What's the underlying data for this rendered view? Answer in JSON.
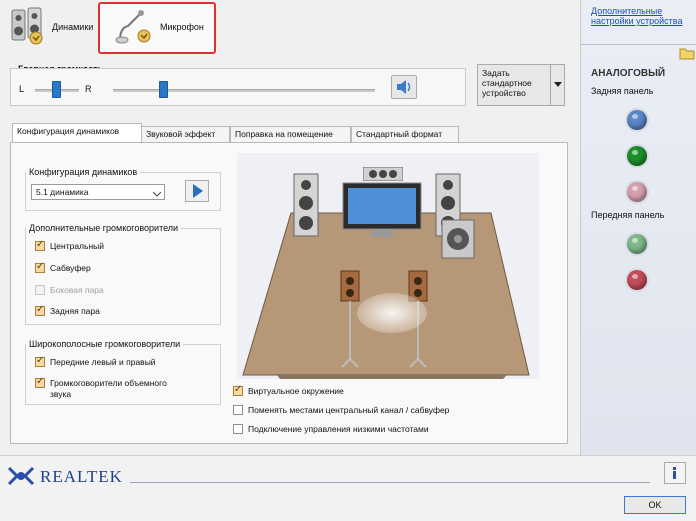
{
  "device_tabs": [
    {
      "label": "Динамики",
      "icon": "speakers-icon"
    },
    {
      "label": "Микрофон",
      "icon": "microphone-icon"
    }
  ],
  "volume": {
    "title": "Главная громкость",
    "left_label": "L",
    "right_label": "R",
    "default_button_label": "Задать стандартное устройство"
  },
  "tabs": [
    "Конфигурация динамиков",
    "Звуковой эффект",
    "Поправка на помещение",
    "Стандартный формат"
  ],
  "speaker_config": {
    "group_title": "Конфигурация динамиков",
    "selected": "5.1 динамика"
  },
  "additional_speakers": {
    "group_title": "Дополнительные громкоговорители",
    "items": [
      {
        "label": "Центральный",
        "checked": true,
        "disabled": false
      },
      {
        "label": "Сабвуфер",
        "checked": true,
        "disabled": false
      },
      {
        "label": "Боковая пара",
        "checked": false,
        "disabled": true
      },
      {
        "label": "Задняя пара",
        "checked": true,
        "disabled": false
      }
    ]
  },
  "fullrange_speakers": {
    "group_title": "Широкополосные громкоговорители",
    "items": [
      {
        "label": "Передние левый и правый",
        "checked": true
      },
      {
        "label": "Громкоговорители объемного звука",
        "checked": true
      }
    ]
  },
  "options": [
    {
      "label": "Виртуальное окружение",
      "checked": true
    },
    {
      "label": "Поменять местами центральный канал / сабвуфер",
      "checked": false
    },
    {
      "label": "Подключение управления низкими частотами",
      "checked": false
    }
  ],
  "right_panel": {
    "advanced_link": "Дополнительные настройки устройства",
    "analog_title": "АНАЛОГОВЫЙ",
    "rear_panel": "Задняя панель",
    "front_panel": "Передняя панель",
    "rear_jacks": [
      "#5b86c8",
      "#1e8f2a",
      "#d7a0ae"
    ],
    "front_jacks": [
      "#7fb88a",
      "#c44c5a"
    ]
  },
  "brand": "REALTEK",
  "ok_label": "OK",
  "info_icon": "info-icon"
}
